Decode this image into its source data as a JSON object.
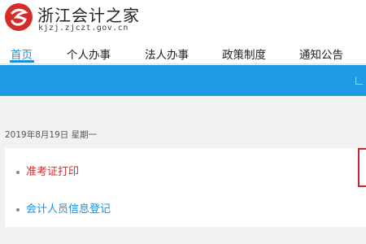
{
  "header": {
    "site_name": "浙江会计之家",
    "site_domain": "kjzj.zjczt.gov.cn",
    "logo_icon": "red-swirl-logo"
  },
  "nav": {
    "items": [
      {
        "label": "首页",
        "active": true
      },
      {
        "label": "个人办事",
        "active": false
      },
      {
        "label": "法人办事",
        "active": false
      },
      {
        "label": "政策制度",
        "active": false
      },
      {
        "label": "通知公告",
        "active": false
      }
    ]
  },
  "colors": {
    "accent": "#1a8fe0",
    "banner": "#1f9be3",
    "highlight_link": "#d52525",
    "logo_red": "#d42b2b"
  },
  "main": {
    "date": "2019年8月19日  星期一",
    "links": [
      {
        "label": "准考证打印"
      },
      {
        "label": "会计人员信息登记"
      }
    ]
  }
}
